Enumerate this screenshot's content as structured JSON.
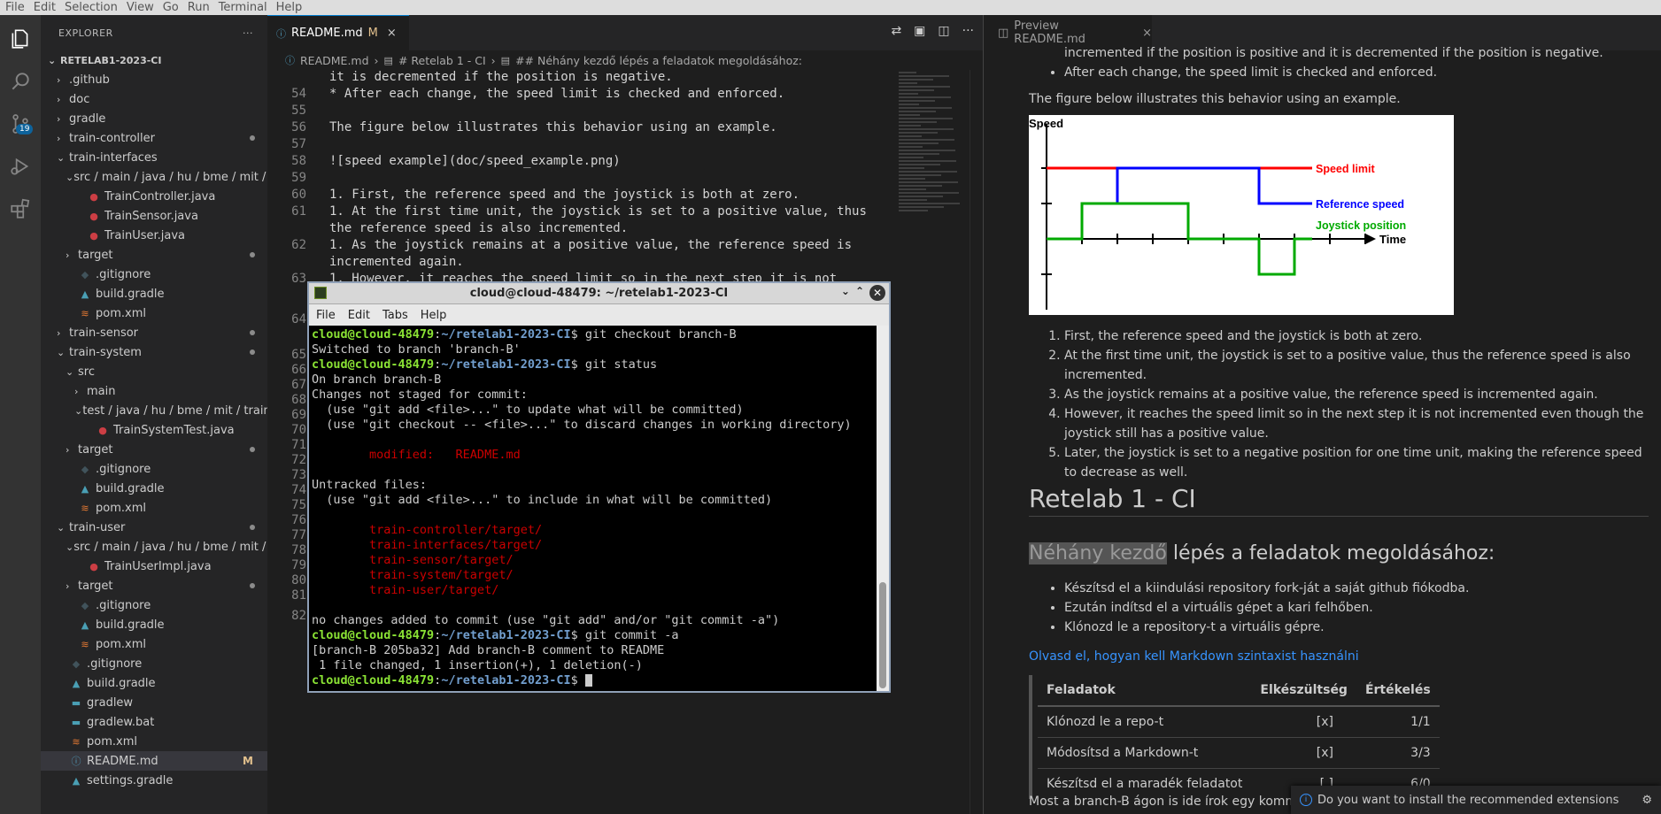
{
  "menubar": [
    "File",
    "Edit",
    "Selection",
    "View",
    "Go",
    "Run",
    "Terminal",
    "Help"
  ],
  "activity": {
    "scm_badge": "19"
  },
  "explorer": {
    "title": "EXPLORER",
    "more": "···",
    "root": "RETELAB1-2023-CI",
    "items": [
      {
        "label": ".github",
        "depth": 1,
        "kind": "folder-closed"
      },
      {
        "label": "doc",
        "depth": 1,
        "kind": "folder-closed"
      },
      {
        "label": "gradle",
        "depth": 1,
        "kind": "folder-closed"
      },
      {
        "label": "train-controller",
        "depth": 1,
        "kind": "folder-closed",
        "dot": true
      },
      {
        "label": "train-interfaces",
        "depth": 1,
        "kind": "folder-open"
      },
      {
        "label": "src / main / java / hu / bme / mit / t...",
        "depth": 2,
        "kind": "folder-open"
      },
      {
        "label": "TrainController.java",
        "depth": 3,
        "kind": "java"
      },
      {
        "label": "TrainSensor.java",
        "depth": 3,
        "kind": "java"
      },
      {
        "label": "TrainUser.java",
        "depth": 3,
        "kind": "java"
      },
      {
        "label": "target",
        "depth": 2,
        "kind": "folder-closed",
        "dot": true
      },
      {
        "label": ".gitignore",
        "depth": 2,
        "kind": "git"
      },
      {
        "label": "build.gradle",
        "depth": 2,
        "kind": "gradle"
      },
      {
        "label": "pom.xml",
        "depth": 2,
        "kind": "xml"
      },
      {
        "label": "train-sensor",
        "depth": 1,
        "kind": "folder-closed",
        "dot": true
      },
      {
        "label": "train-system",
        "depth": 1,
        "kind": "folder-open",
        "dot": true
      },
      {
        "label": "src",
        "depth": 2,
        "kind": "folder-open"
      },
      {
        "label": "main",
        "depth": 3,
        "kind": "folder-closed"
      },
      {
        "label": "test / java / hu / bme / mit / train...",
        "depth": 3,
        "kind": "folder-open"
      },
      {
        "label": "TrainSystemTest.java",
        "depth": 4,
        "kind": "java"
      },
      {
        "label": "target",
        "depth": 2,
        "kind": "folder-closed",
        "dot": true
      },
      {
        "label": ".gitignore",
        "depth": 2,
        "kind": "git"
      },
      {
        "label": "build.gradle",
        "depth": 2,
        "kind": "gradle"
      },
      {
        "label": "pom.xml",
        "depth": 2,
        "kind": "xml"
      },
      {
        "label": "train-user",
        "depth": 1,
        "kind": "folder-open",
        "dot": true
      },
      {
        "label": "src / main / java / hu / bme / mit / t...",
        "depth": 2,
        "kind": "folder-open"
      },
      {
        "label": "TrainUserImpl.java",
        "depth": 3,
        "kind": "java"
      },
      {
        "label": "target",
        "depth": 2,
        "kind": "folder-closed",
        "dot": true
      },
      {
        "label": ".gitignore",
        "depth": 2,
        "kind": "git"
      },
      {
        "label": "build.gradle",
        "depth": 2,
        "kind": "gradle"
      },
      {
        "label": "pom.xml",
        "depth": 2,
        "kind": "xml"
      },
      {
        "label": ".gitignore",
        "depth": 1,
        "kind": "git"
      },
      {
        "label": "build.gradle",
        "depth": 1,
        "kind": "gradle"
      },
      {
        "label": "gradlew",
        "depth": 1,
        "kind": "plain"
      },
      {
        "label": "gradlew.bat",
        "depth": 1,
        "kind": "bat"
      },
      {
        "label": "pom.xml",
        "depth": 1,
        "kind": "xml"
      },
      {
        "label": "README.md",
        "depth": 1,
        "kind": "info",
        "selected": true,
        "mod": "M"
      },
      {
        "label": "settings.gradle",
        "depth": 1,
        "kind": "gradle"
      }
    ]
  },
  "editor": {
    "tab_label": "README.md",
    "tab_mod": "M",
    "tab_close": "×",
    "breadcrumb": [
      "README.md",
      "# Retelab 1 - CI",
      "## Néhány kezdő lépés a feladatok megoldásához:"
    ],
    "lines": [
      {
        "n": "",
        "t": "it is decremented if the position is negative."
      },
      {
        "n": "54",
        "t": "* After each change, the speed limit is checked and enforced."
      },
      {
        "n": "55",
        "t": ""
      },
      {
        "n": "56",
        "t": "The figure below illustrates this behavior using an example."
      },
      {
        "n": "57",
        "t": ""
      },
      {
        "n": "58",
        "t": "![speed example](doc/speed_example.png)"
      },
      {
        "n": "59",
        "t": ""
      },
      {
        "n": "60",
        "t": "1. First, the reference speed and the joystick is both at zero."
      },
      {
        "n": "61",
        "t": "1. At the first time unit, the joystick is set to a positive value, thus"
      },
      {
        "n": "",
        "t": "the reference speed is also incremented."
      },
      {
        "n": "62",
        "t": "1. As the joystick remains at a positive value, the reference speed is"
      },
      {
        "n": "",
        "t": "incremented again."
      },
      {
        "n": "63",
        "t": "1. However, it reaches the speed limit so in the next step it is not"
      }
    ],
    "gutter_only": [
      "64",
      "65",
      "66",
      "67",
      "68",
      "69",
      "70",
      "71",
      "72",
      "73",
      "74",
      "75",
      "76",
      "77",
      "78",
      "79",
      "80",
      "81",
      "82"
    ]
  },
  "terminal": {
    "title": "cloud@cloud-48479: ~/retelab1-2023-CI",
    "menu": [
      "File",
      "Edit",
      "Tabs",
      "Help"
    ],
    "user_host": "cloud@cloud-48479",
    "path": "~/retelab1-2023-CI",
    "lines": [
      {
        "type": "prompt",
        "cmd": " git checkout branch-B"
      },
      {
        "type": "out",
        "text": "Switched to branch 'branch-B'"
      },
      {
        "type": "prompt",
        "cmd": " git status"
      },
      {
        "type": "out",
        "text": "On branch branch-B"
      },
      {
        "type": "out",
        "text": "Changes not staged for commit:"
      },
      {
        "type": "out",
        "text": "  (use \"git add <file>...\" to update what will be committed)"
      },
      {
        "type": "out",
        "text": "  (use \"git checkout -- <file>...\" to discard changes in working directory)"
      },
      {
        "type": "out",
        "text": ""
      },
      {
        "type": "red",
        "text": "        modified:   README.md"
      },
      {
        "type": "out",
        "text": ""
      },
      {
        "type": "out",
        "text": "Untracked files:"
      },
      {
        "type": "out",
        "text": "  (use \"git add <file>...\" to include in what will be committed)"
      },
      {
        "type": "out",
        "text": ""
      },
      {
        "type": "red",
        "text": "        train-controller/target/"
      },
      {
        "type": "red",
        "text": "        train-interfaces/target/"
      },
      {
        "type": "red",
        "text": "        train-sensor/target/"
      },
      {
        "type": "red",
        "text": "        train-system/target/"
      },
      {
        "type": "red",
        "text": "        train-user/target/"
      },
      {
        "type": "out",
        "text": ""
      },
      {
        "type": "out",
        "text": "no changes added to commit (use \"git add\" and/or \"git commit -a\")"
      },
      {
        "type": "prompt",
        "cmd": " git commit -a"
      },
      {
        "type": "out",
        "text": "[branch-B 205ba32] Add branch-B comment to README"
      },
      {
        "type": "out",
        "text": " 1 file changed, 1 insertion(+), 1 deletion(-)"
      },
      {
        "type": "prompt",
        "cmd": " ",
        "cursor": true
      }
    ]
  },
  "preview": {
    "tab_label": "Preview README.md",
    "tab_close": "×",
    "clip_top": "incremented if the position is positive and it is decremented if the position is negative.",
    "bullet_after": "After each change, the speed limit is checked and enforced.",
    "figure_intro": "The figure below illustrates this behavior using an example.",
    "steps": [
      "First, the reference speed and the joystick is both at zero.",
      "At the first time unit, the joystick is set to a positive value, thus the reference speed is also incremented.",
      "As the joystick remains at a positive value, the reference speed is incremented again.",
      "However, it reaches the speed limit so in the next step it is not incremented even though the joystick still has a positive value.",
      "Later, the joystick is set to a negative position for one time unit, making the reference speed to decrease as well."
    ],
    "h1": "Retelab 1 - CI",
    "h2_highlight": "Néhány kezdő",
    "h2_rest": " lépés a feladatok megoldásához:",
    "hu_bullets": [
      "Készítsd el a kiindulási repository fork-ját a saját github fiókodba.",
      "Ezután indítsd el a virtuális gépet a kari felhőben.",
      "Klónozd le a repository-t a virtuális gépre."
    ],
    "link": "Olvasd el, hogyan kell Markdown szintaxist használni",
    "table": {
      "headers": [
        "Feladatok",
        "Elkészültség",
        "Értékelés"
      ],
      "rows": [
        [
          "Klónozd le a repo-t",
          "[x]",
          "1/1"
        ],
        [
          "Módosítsd a Markdown-t",
          "[x]",
          "3/3"
        ],
        [
          "Készítsd el a maradék feladatot",
          "[ ]",
          "6/0"
        ]
      ]
    },
    "last_line": "Most a branch-B ágon is ide írok egy komm",
    "chart": {
      "ylabel": "Speed",
      "xlabel": "Time",
      "legend": [
        "Speed limit",
        "Reference speed",
        "Joystick position"
      ],
      "colors": [
        "#ff0000",
        "#0000ff",
        "#00aa00"
      ]
    }
  },
  "chart_data": {
    "type": "line",
    "ylabel": "Speed",
    "xlabel": "Time",
    "x": [
      0,
      1,
      2,
      3,
      4,
      5,
      6,
      7,
      8,
      9
    ],
    "series": [
      {
        "name": "Speed limit",
        "values": [
          2,
          2,
          2,
          2,
          2,
          2,
          2,
          2,
          2,
          2
        ]
      },
      {
        "name": "Reference speed",
        "values": [
          0,
          1,
          2,
          2,
          2,
          2,
          1,
          1,
          1,
          1
        ]
      },
      {
        "name": "Joystick position",
        "values": [
          0,
          1,
          1,
          1,
          0,
          0,
          -1,
          0,
          0,
          0
        ]
      }
    ]
  },
  "notification": {
    "text": "Do you want to install the recommended extensions",
    "gear": "⚙"
  }
}
